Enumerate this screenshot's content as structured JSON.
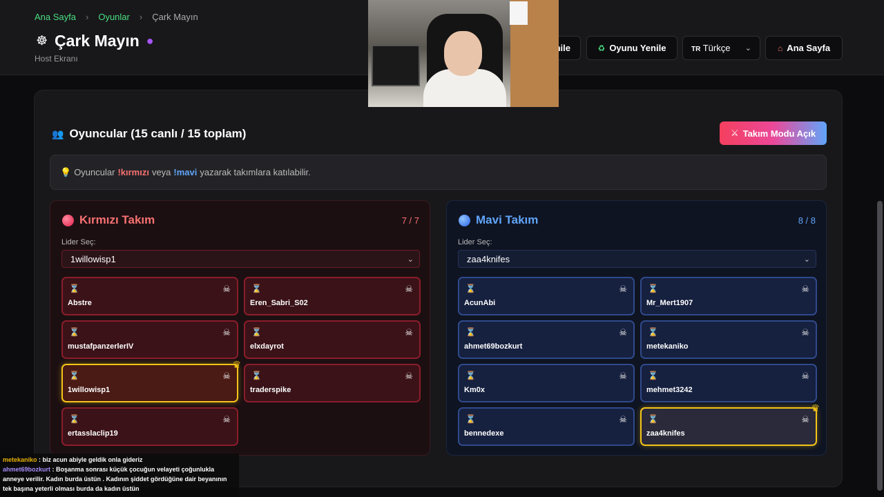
{
  "breadcrumb": {
    "home": "Ana Sayfa",
    "games": "Oyunlar",
    "current": "Çark Mayın"
  },
  "page": {
    "title": "Çark Mayın",
    "subtitle": "Host Ekranı"
  },
  "header_buttons": {
    "partial": "nile",
    "restart": "Oyunu Yenile",
    "language": "Türkçe",
    "home": "Ana Sayfa"
  },
  "players": {
    "title": "Oyuncular (15 canlı / 15 toplam)",
    "team_mode_button": "Takım Modu Açık"
  },
  "info": {
    "prefix": "Oyuncular",
    "red_cmd": "!kırmızı",
    "mid": "veya",
    "blue_cmd": "!mavi",
    "suffix": "yazarak takımlara katılabilir."
  },
  "red_team": {
    "name": "Kırmızı Takım",
    "count": "7 / 7",
    "leader_label": "Lider Seç:",
    "leader": "1willowisp1",
    "members": [
      "Abstre",
      "Eren_Sabri_S02",
      "mustafpanzerlerIV",
      "elxdayrot",
      "1willowisp1",
      "traderspike",
      "ertasslaclip19"
    ]
  },
  "blue_team": {
    "name": "Mavi Takım",
    "count": "8 / 8",
    "leader_label": "Lider Seç:",
    "leader": "zaa4knifes",
    "members": [
      "AcunAbi",
      "Mr_Mert1907",
      "ahmet69bozkurt",
      "metekaniko",
      "Km0x",
      "mehmet3242",
      "bennedexe",
      "zaa4knifes"
    ]
  },
  "chat": [
    {
      "user": "metekaniko",
      "text": " : biz acun abiyle geldik onla gideriz"
    },
    {
      "user": "ahmet69bozkurt",
      "text": " : Boşanma sonrası küçük çocuğun velayeti çoğunlukla anneye verilir. Kadın burda üstün . Kadının şiddet gördüğüne dair beyanının tek başına yeterli olması burda da kadın üstün"
    }
  ],
  "colors": {
    "accent_green": "#4ade80",
    "red": "#f87171",
    "blue": "#60a5fa",
    "leader_gold": "#f5c518"
  },
  "icons": {
    "wheel": "ferris-wheel-icon",
    "bomb": "bomb-icon",
    "recycle": "recycle-icon",
    "house": "house-icon",
    "people": "people-icon",
    "swords": "crossed-swords-icon",
    "bulb": "lightbulb-icon",
    "hourglass": "hourglass-icon",
    "kick": "skull-crossbones-icon",
    "crown": "crown-icon"
  }
}
